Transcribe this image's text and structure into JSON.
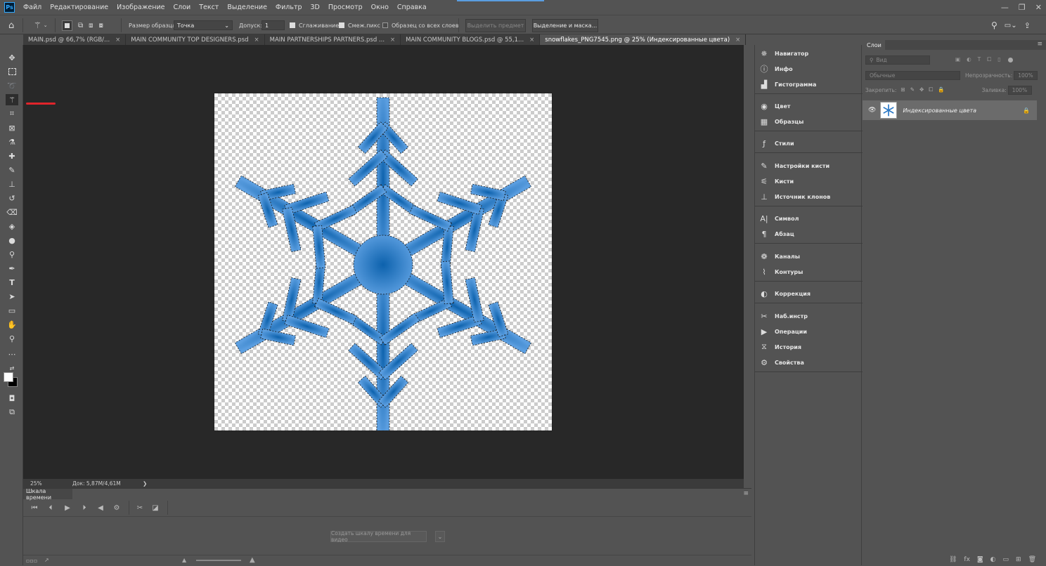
{
  "menu": {
    "logo": "Ps",
    "items": [
      "Файл",
      "Редактирование",
      "Изображение",
      "Слои",
      "Текст",
      "Выделение",
      "Фильтр",
      "3D",
      "Просмотр",
      "Окно",
      "Справка"
    ],
    "window_controls": {
      "minimize": "—",
      "restore": "❐",
      "close": "✕"
    }
  },
  "options": {
    "sample_size_label": "Размер образца:",
    "sample_size_value": "Точка",
    "tolerance_label": "Допуск:",
    "tolerance_value": "1",
    "antialias_label": "Сглаживание",
    "antialias_checked": true,
    "contiguous_label": "Смеж.пикс",
    "contiguous_checked": true,
    "all_layers_label": "Образец со всех слоев",
    "all_layers_checked": false,
    "select_subject_label": "Выделить предмет",
    "select_mask_label": "Выделение и маска..."
  },
  "tabs": [
    {
      "label": "MAIN.psd @ 66,7% (RGB/...",
      "close": "×",
      "active": false
    },
    {
      "label": "MAIN COMMUNITY TOP DESIGNERS.psd",
      "close": "×",
      "active": false
    },
    {
      "label": "MAIN PARTNERSHIPS PARTNERS.psd ...",
      "close": "×",
      "active": false
    },
    {
      "label": "MAIN COMMUNITY BLOGS.psd @ 55,1...",
      "close": "×",
      "active": false
    },
    {
      "label": "snowflakes_PNG7545.png @ 25% (Индексированные цвета)",
      "close": "×",
      "active": true
    }
  ],
  "status": {
    "zoom": "25%",
    "doc": "Док: 5,87M/4,61M",
    "arrow": "❯"
  },
  "timeline": {
    "title": "Шкала времени",
    "create_button": "Создать шкалу времени для видео"
  },
  "panels": [
    {
      "label": "Навигатор",
      "icon": "navigator-icon"
    },
    {
      "label": "Инфо",
      "icon": "info-icon"
    },
    {
      "label": "Гистограмма",
      "icon": "histogram-icon"
    },
    {
      "label": "Цвет",
      "icon": "color-icon"
    },
    {
      "label": "Образцы",
      "icon": "swatches-icon"
    },
    {
      "label": "Стили",
      "icon": "styles-icon"
    },
    {
      "label": "Настройки кисти",
      "icon": "brush-settings-icon"
    },
    {
      "label": "Кисти",
      "icon": "brushes-icon"
    },
    {
      "label": "Источник клонов",
      "icon": "clone-source-icon"
    },
    {
      "label": "Символ",
      "icon": "character-icon"
    },
    {
      "label": "Абзац",
      "icon": "paragraph-icon"
    },
    {
      "label": "Каналы",
      "icon": "channels-icon"
    },
    {
      "label": "Контуры",
      "icon": "paths-icon"
    },
    {
      "label": "Коррекция",
      "icon": "adjustments-icon"
    },
    {
      "label": "Наб.инстр",
      "icon": "tool-presets-icon"
    },
    {
      "label": "Операции",
      "icon": "actions-icon"
    },
    {
      "label": "История",
      "icon": "history-icon"
    },
    {
      "label": "Свойства",
      "icon": "properties-icon"
    }
  ],
  "layers": {
    "tab": "Слои",
    "filter_placeholder": "Вид",
    "blend_mode": "Обычные",
    "opacity_label": "Непрозрачность:",
    "opacity_value": "100%",
    "lock_label": "Закрепить:",
    "fill_label": "Заливка:",
    "fill_value": "100%",
    "layer_name": "Индексированные цвета"
  },
  "colors": {
    "accent": "#31a8ff",
    "snowflake_light": "#5b9ee0",
    "snowflake_dark": "#0d62ad",
    "marker": "#e0242b"
  }
}
